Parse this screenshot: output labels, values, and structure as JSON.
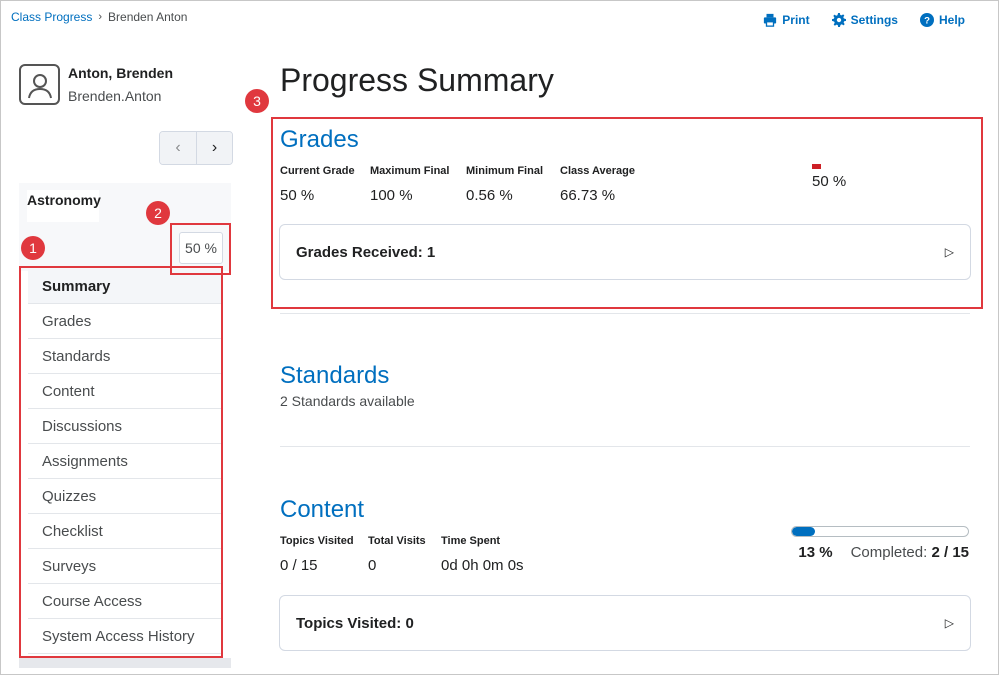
{
  "breadcrumb": {
    "root": "Class Progress",
    "separator": "›",
    "current": "Brenden Anton"
  },
  "toolbar": {
    "print": "Print",
    "settings": "Settings",
    "help": "Help"
  },
  "user": {
    "name": "Anton, Brenden",
    "login": "Brenden.Anton"
  },
  "pager": {
    "prev": "‹",
    "next": "›"
  },
  "sidebar": {
    "course": "Astronomy",
    "course_percent": "50 %",
    "items": [
      {
        "label": "Summary"
      },
      {
        "label": "Grades"
      },
      {
        "label": "Standards"
      },
      {
        "label": "Content"
      },
      {
        "label": "Discussions"
      },
      {
        "label": "Assignments"
      },
      {
        "label": "Quizzes"
      },
      {
        "label": "Checklist"
      },
      {
        "label": "Surveys"
      },
      {
        "label": "Course Access"
      },
      {
        "label": "System Access History"
      }
    ]
  },
  "callouts": [
    "1",
    "2",
    "3"
  ],
  "main": {
    "title": "Progress Summary",
    "grades": {
      "title": "Grades",
      "labels": [
        "Current Grade",
        "Maximum Final",
        "Minimum Final",
        "Class Average"
      ],
      "values": [
        "50 %",
        "100 %",
        "0.56 %",
        "66.73 %"
      ],
      "chart_percent": "50 %",
      "expander": "Grades Received: 1"
    },
    "standards": {
      "title": "Standards",
      "subtitle": "2 Standards available"
    },
    "content": {
      "title": "Content",
      "labels": [
        "Topics Visited",
        "Total Visits",
        "Time Spent"
      ],
      "values": [
        "0 / 15",
        "0",
        "0d 0h 0m 0s"
      ],
      "progress_fraction": 0.13,
      "progress_percent": "13 %",
      "completed_label": "Completed:",
      "completed_value": "2 / 15",
      "expander": "Topics Visited: 0"
    }
  },
  "colors": {
    "accent": "#006fbf",
    "callout": "#e0383e",
    "grade_bar": "#cd2026"
  }
}
